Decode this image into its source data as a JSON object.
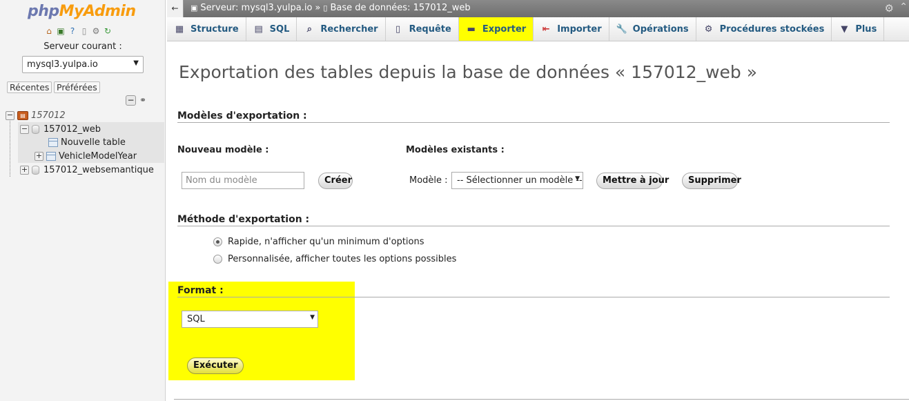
{
  "nav": {
    "logo_php": "php",
    "logo_myadmin": "MyAdmin",
    "icons": [
      "home-icon",
      "exit-icon",
      "help-icon",
      "docs-icon",
      "settings-icon",
      "reload-icon"
    ],
    "server_label": "Serveur courant :",
    "server_value": "mysql3.yulpa.io",
    "recent_label": "Récentes",
    "favorites_label": "Préférées",
    "tree": {
      "server_node": "157012",
      "db_node": "157012_web",
      "new_table": "Nouvelle table",
      "table_1": "VehicleModelYear",
      "db_node_2": "157012_websemantique"
    }
  },
  "topbar": {
    "back": "←",
    "server_crumb": "Serveur: mysql3.yulpa.io",
    "separator": "»",
    "db_crumb": "Base de données: 157012_web"
  },
  "tabs": [
    {
      "label": "Structure",
      "icon": "structure-icon"
    },
    {
      "label": "SQL",
      "icon": "sql-icon"
    },
    {
      "label": "Rechercher",
      "icon": "search-icon"
    },
    {
      "label": "Requête",
      "icon": "query-icon"
    },
    {
      "label": "Exporter",
      "icon": "export-icon",
      "active": true
    },
    {
      "label": "Importer",
      "icon": "import-icon"
    },
    {
      "label": "Opérations",
      "icon": "operations-icon"
    },
    {
      "label": "Procédures stockées",
      "icon": "routines-icon"
    },
    {
      "label": "Plus",
      "icon": "more-icon"
    }
  ],
  "main": {
    "title": "Exportation des tables depuis la base de données « 157012_web »",
    "templates": {
      "heading": "Modèles d'exportation :",
      "new_heading": "Nouveau modèle :",
      "existing_heading": "Modèles existants :",
      "name_placeholder": "Nom du modèle",
      "create_button": "Créer",
      "model_label": "Modèle :",
      "model_select": "-- Sélectionner un modèle --",
      "update_button": "Mettre à jour",
      "delete_button": "Supprimer"
    },
    "method": {
      "heading": "Méthode d'exportation :",
      "quick": "Rapide, n'afficher qu'un minimum d'options",
      "custom": "Personnalisée, afficher toutes les options possibles"
    },
    "format": {
      "heading": "Format :",
      "value": "SQL",
      "execute_button": "Exécuter"
    }
  },
  "colors": {
    "highlight": "#ffff00",
    "tab_text": "#235a81",
    "logo_php": "#6c78af",
    "logo_myadmin": "#f89c0e"
  }
}
